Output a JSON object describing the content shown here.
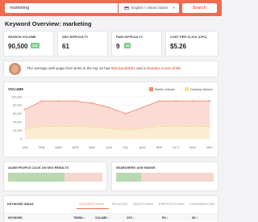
{
  "search": {
    "query": "marketing",
    "locale": "English / United States",
    "button": "Search"
  },
  "page_title": "Keyword Overview: marketing",
  "metrics": [
    {
      "label": "SEARCH VOLUME",
      "value": "90,500",
      "tag": "$$$"
    },
    {
      "label": "SEO DIFFICULTY",
      "value": "61",
      "tag": ""
    },
    {
      "label": "PAID DIFFICULTY",
      "value": "9",
      "tag": "$$"
    },
    {
      "label": "COST PER CLICK (CPC)",
      "value": "$5.26",
      "tag": ""
    }
  ],
  "banner": {
    "prefix": "The average web page that ranks in the top 10 has ",
    "backlinks": "815 backlinks",
    "middle": " and a ",
    "domain_score": "domain score of 86",
    "suffix": "."
  },
  "volume": {
    "title": "VOLUME",
    "legend_mobile": "Mobile Volume",
    "legend_desktop": "Desktop Volume",
    "color_mobile": "#f08a72",
    "color_desktop": "#f6dd9a"
  },
  "chart_data": {
    "type": "area",
    "categories": [
      "JAN",
      "FEB",
      "MAR",
      "APR",
      "MAY",
      "JUN",
      "JUL",
      "AUG",
      "SEP",
      "OCT",
      "NOV",
      "DEC"
    ],
    "series": [
      {
        "name": "Mobile Volume",
        "values": [
          70000,
          90000,
          90000,
          90000,
          85000,
          75000,
          60000,
          75000,
          90000,
          90000,
          90000,
          90000
        ]
      },
      {
        "name": "Desktop Volume",
        "values": [
          24000,
          30000,
          30000,
          30000,
          28000,
          25000,
          20000,
          25000,
          30000,
          30000,
          30000,
          30000
        ]
      }
    ],
    "yticks": [
      "100,000",
      "80,000",
      "60,000",
      "40,000",
      "20,000",
      "0"
    ],
    "ylim": [
      0,
      100000
    ],
    "grid": true,
    "legend": "top-right"
  },
  "seo_click": {
    "title": "24,889 PEOPLE CLICK ON SEO RESULTS",
    "fraction": 0.6
  },
  "age_range": {
    "title": "SEARCHERS' AGE RANGE",
    "fraction": 0.26
  },
  "ideas": {
    "title": "KEYWORD IDEAS",
    "tabs": [
      "SUGGESTIONS",
      "RELATED",
      "QUESTIONS",
      "PREPOSITIONS",
      "COMPARISONS"
    ],
    "columns": [
      "KEYWORD",
      "TREND",
      "VOLUME",
      "CPC",
      "PD",
      "SD"
    ]
  }
}
